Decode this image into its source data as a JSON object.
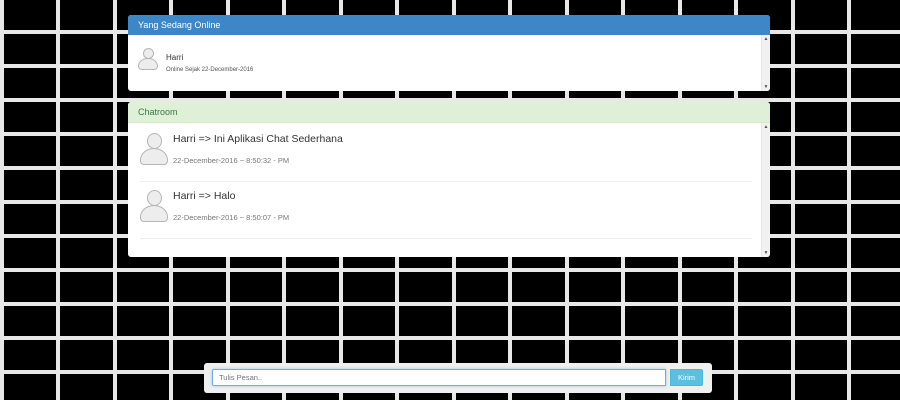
{
  "online_panel": {
    "title": "Yang Sedang Online",
    "users": [
      {
        "name": "Harri",
        "status": "Online Sejak 22-December-2016"
      }
    ]
  },
  "chat_panel": {
    "title": "Chatroom",
    "messages": [
      {
        "text": "Harri => Ini Aplikasi Chat Sederhana",
        "time": "22-December-2016 ~ 8:50:32 - PM"
      },
      {
        "text": "Harri => Halo",
        "time": "22-December-2016 ~ 8:50:07 - PM"
      }
    ]
  },
  "composer": {
    "placeholder": "Tulis Pesan..",
    "send_label": "Kirim"
  },
  "colors": {
    "primary_heading": "#3d86c8",
    "success_heading": "#dff0d8",
    "send_button": "#5bc0de"
  }
}
